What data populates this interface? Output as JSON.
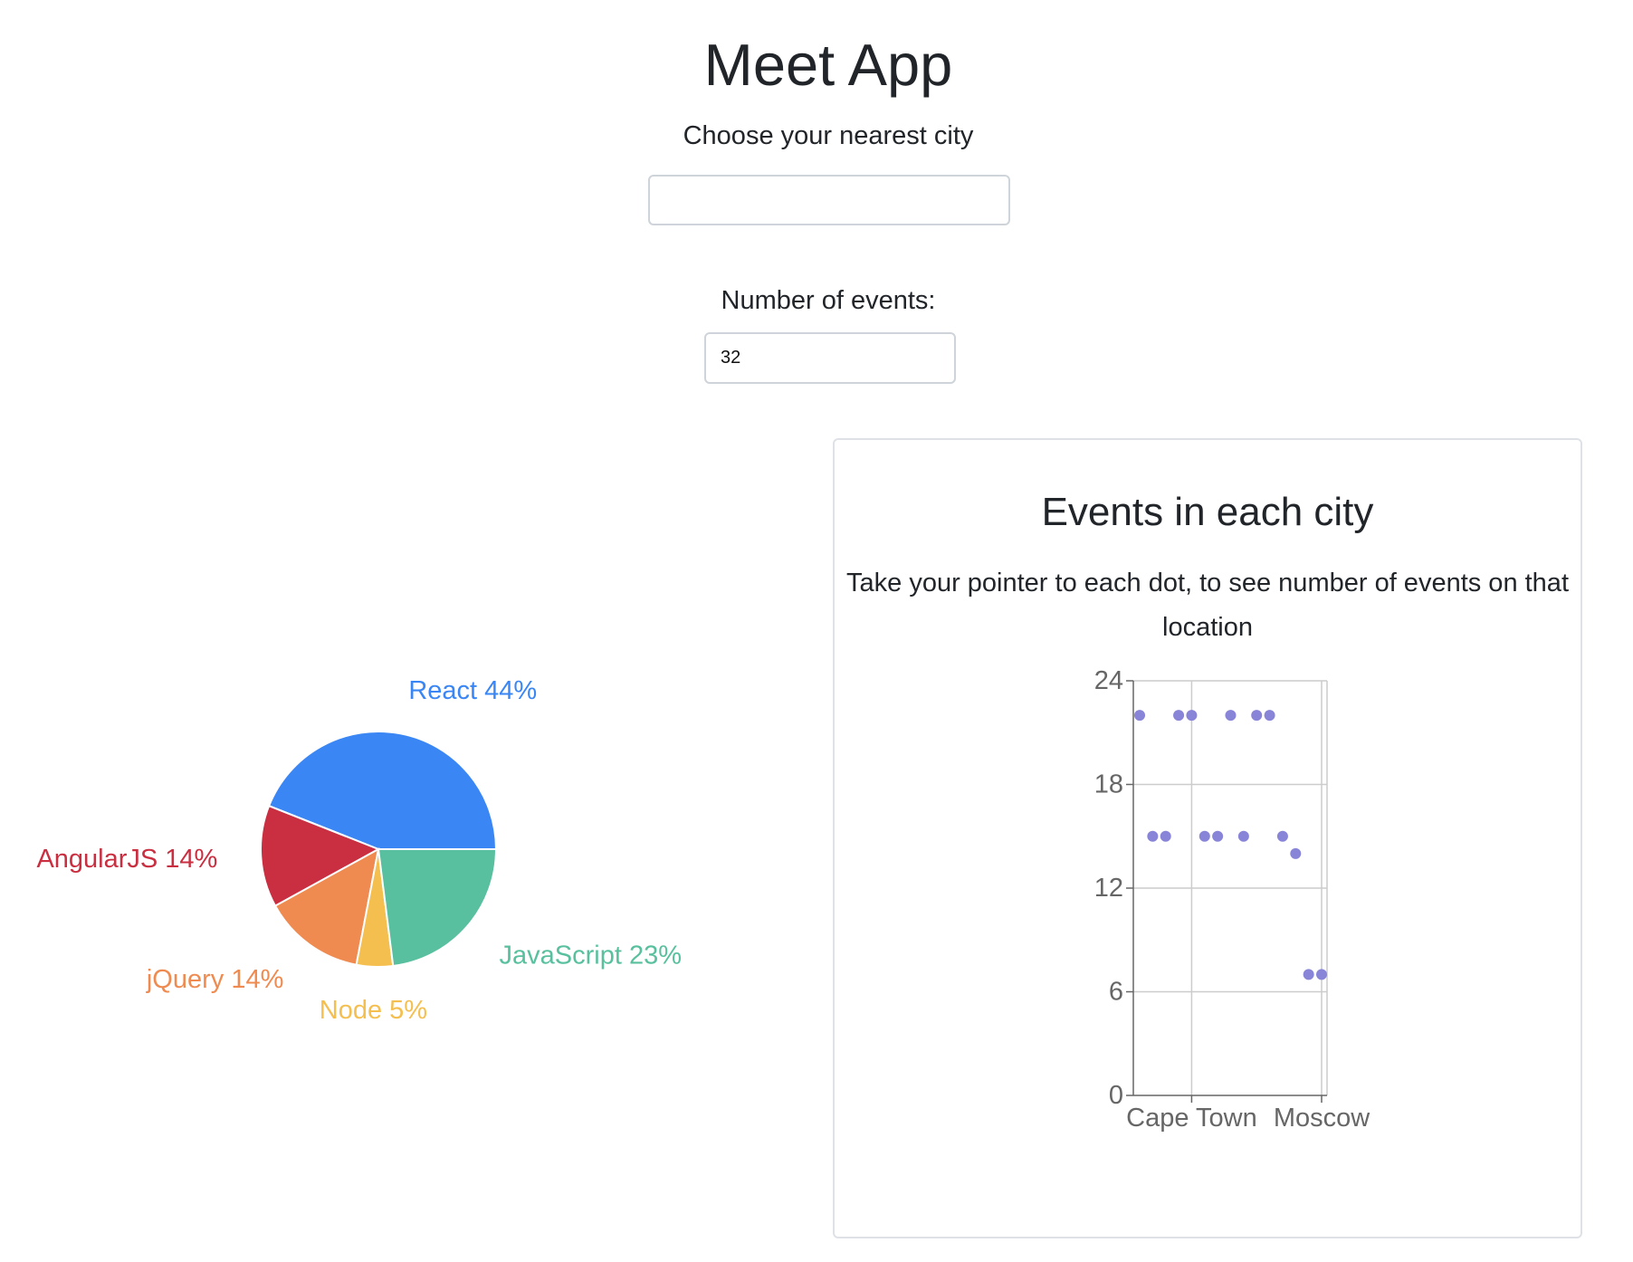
{
  "app": {
    "title": "Meet App"
  },
  "city_search": {
    "label": "Choose your nearest city",
    "value": "",
    "placeholder": ""
  },
  "number_of_events": {
    "label": "Number of events:",
    "value": "32"
  },
  "scatter_card": {
    "title": "Events in each city",
    "description": "Take your pointer to each dot, to see number of events on that location"
  },
  "colors": {
    "react": "#3a86f5",
    "angularjs": "#c92f41",
    "jquery": "#ef8b50",
    "node": "#f4bf4f",
    "javascript": "#58c09e",
    "scatter_dot": "#8884d8",
    "axis_text": "#666666",
    "grid": "#cccccc"
  },
  "chart_data": [
    {
      "type": "pie",
      "slices": [
        {
          "label": "React",
          "percent_label": "React 44%",
          "value": 44,
          "color": "#3a86f5"
        },
        {
          "label": "AngularJS",
          "percent_label": "AngularJS 14%",
          "value": 14,
          "color": "#c92f41"
        },
        {
          "label": "jQuery",
          "percent_label": "jQuery 14%",
          "value": 14,
          "color": "#ef8b50"
        },
        {
          "label": "Node",
          "percent_label": "Node 5%",
          "value": 5,
          "color": "#f4bf4f"
        },
        {
          "label": "JavaScript",
          "percent_label": "JavaScript 23%",
          "value": 23,
          "color": "#58c09e"
        }
      ]
    },
    {
      "type": "scatter",
      "x_tick_labels": [
        "Cape Town",
        "Moscow"
      ],
      "x_tick_indices": [
        4,
        14
      ],
      "y_ticks": [
        0,
        6,
        12,
        18,
        24
      ],
      "ylim": [
        0,
        24
      ],
      "grid": true,
      "points": [
        {
          "index": 0,
          "y": 22
        },
        {
          "index": 1,
          "y": 15
        },
        {
          "index": 2,
          "y": 15
        },
        {
          "index": 3,
          "y": 22
        },
        {
          "index": 4,
          "y": 22
        },
        {
          "index": 5,
          "y": 15
        },
        {
          "index": 6,
          "y": 15
        },
        {
          "index": 7,
          "y": 22
        },
        {
          "index": 8,
          "y": 15
        },
        {
          "index": 9,
          "y": 22
        },
        {
          "index": 10,
          "y": 22
        },
        {
          "index": 11,
          "y": 15
        },
        {
          "index": 12,
          "y": 14
        },
        {
          "index": 13,
          "y": 7
        },
        {
          "index": 14,
          "y": 7
        }
      ]
    }
  ]
}
